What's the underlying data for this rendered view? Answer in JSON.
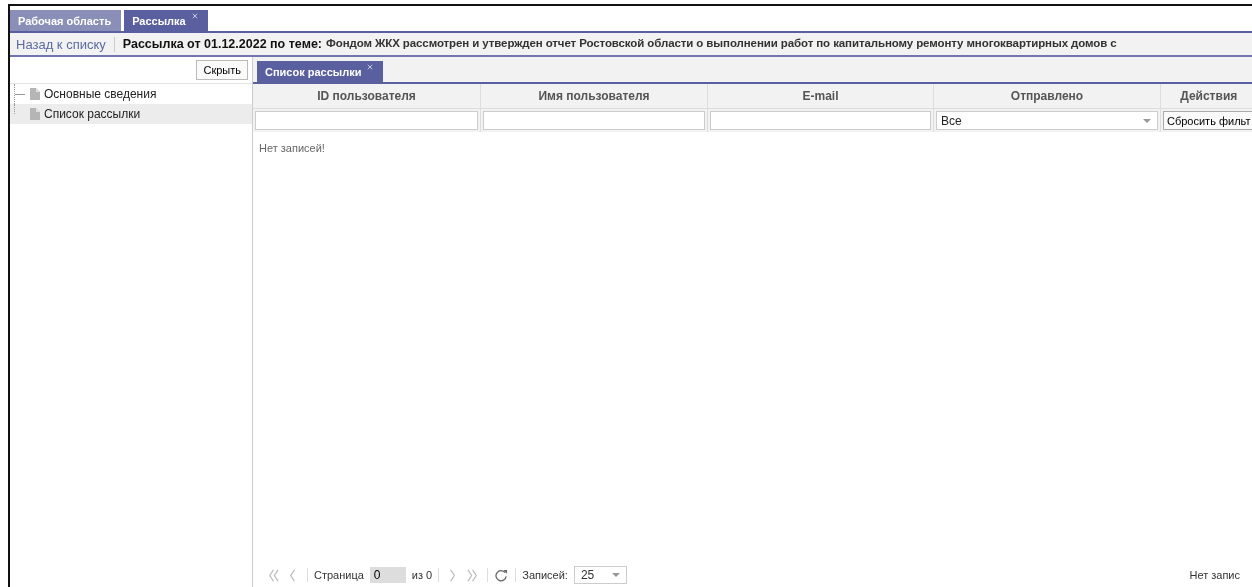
{
  "top_tabs": [
    {
      "label": "Рабочая область",
      "selected": false,
      "closable": false
    },
    {
      "label": "Рассылка",
      "selected": true,
      "closable": true
    }
  ],
  "header": {
    "back_link": "Назад к списку",
    "title": "Рассылка от 01.12.2022 по теме:",
    "subject": "Фондом ЖКХ рассмотрен и утвержден отчет Ростовской области о выполнении работ по капитальному ремонту многоквартирных домов с"
  },
  "sidebar": {
    "hide_button": "Скрыть",
    "items": [
      {
        "label": "Основные сведения",
        "selected": false
      },
      {
        "label": "Список рассылки",
        "selected": true
      }
    ]
  },
  "inner_tabs": [
    {
      "label": "Список рассылки",
      "selected": true,
      "closable": true
    }
  ],
  "table": {
    "columns": [
      {
        "title": "ID пользователя",
        "kind": "text"
      },
      {
        "title": "Имя пользователя",
        "kind": "text"
      },
      {
        "title": "E-mail",
        "kind": "text"
      },
      {
        "title": "Отправлено",
        "kind": "select",
        "filter_value": "Все"
      },
      {
        "title": "Действия",
        "kind": "button",
        "filter_value": "Сбросить фильт"
      }
    ],
    "empty_message": "Нет записей!"
  },
  "pager": {
    "page_label": "Страница",
    "page": "0",
    "of_label": "из 0",
    "per_page_label": "Записей:",
    "per_page": "25",
    "summary": "Нет запис"
  }
}
